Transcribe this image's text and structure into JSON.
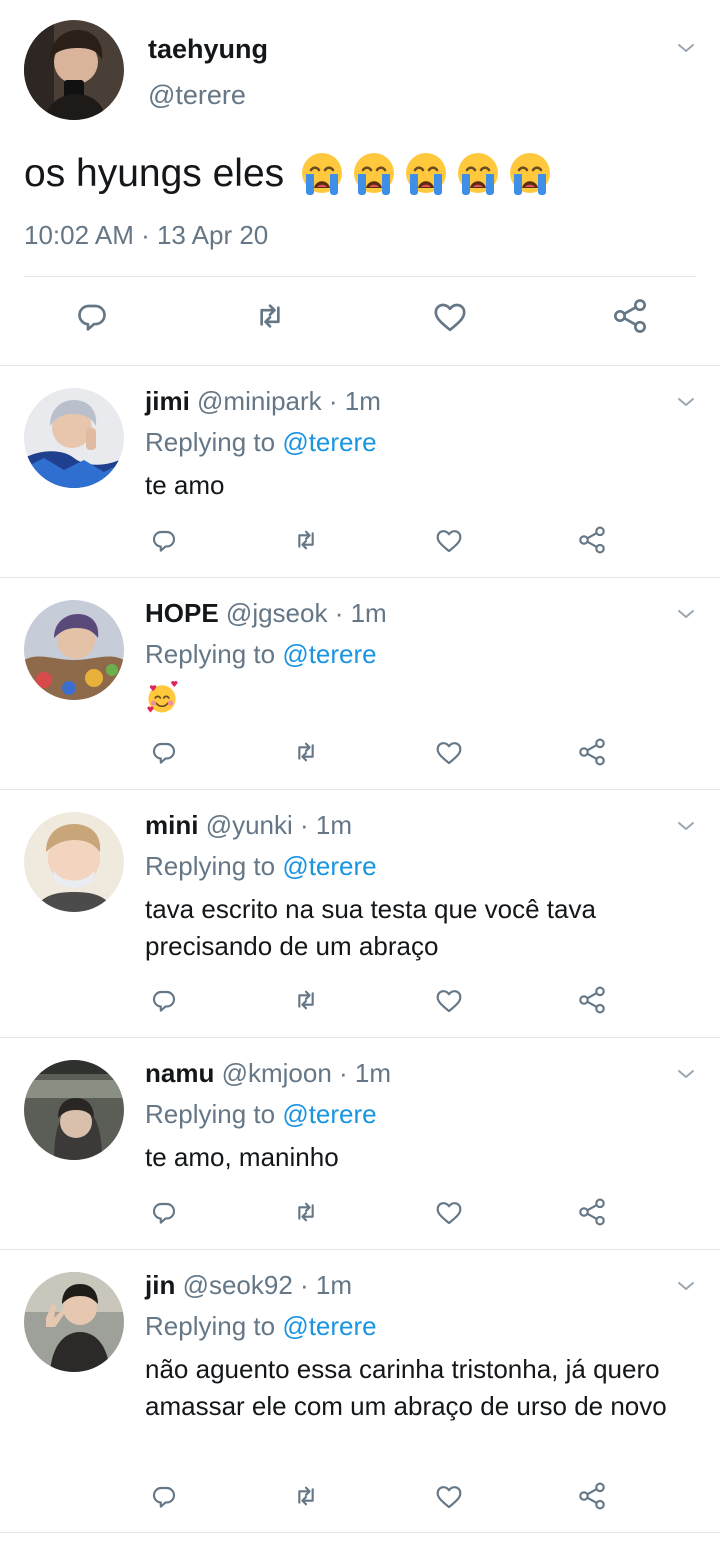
{
  "main_tweet": {
    "name": "taehyung",
    "handle": "@terere",
    "text": "os hyungs eles",
    "emojis": [
      "loudly-crying-face",
      "loudly-crying-face",
      "loudly-crying-face",
      "loudly-crying-face",
      "loudly-crying-face"
    ],
    "timestamp": "10:02 AM · 13 Apr 20"
  },
  "replies": [
    {
      "name": "jimi",
      "handle": "@minipark",
      "time": "· 1m",
      "replying_label": "Replying to",
      "mention": "@terere",
      "text": "te amo"
    },
    {
      "name": "HOPE",
      "handle": "@jgseok",
      "time": "· 1m",
      "replying_label": "Replying to",
      "mention": "@terere",
      "emoji": "smiling-face-with-hearts"
    },
    {
      "name": "mini",
      "handle": "@yunki",
      "time": "· 1m",
      "replying_label": "Replying to",
      "mention": "@terere",
      "text": "tava escrito na sua testa que você tava precisando de um abraço"
    },
    {
      "name": "namu",
      "handle": "@kmjoon",
      "time": "· 1m",
      "replying_label": "Replying to",
      "mention": "@terere",
      "text": "te amo, maninho"
    },
    {
      "name": "jin",
      "handle": "@seok92",
      "time": "· 1m",
      "replying_label": "Replying to",
      "mention": "@terere",
      "text": "não aguento essa carinha tristonha, já quero amassar ele com um abraço de urso de novo"
    }
  ],
  "icons": [
    "reply-icon",
    "retweet-icon",
    "like-icon",
    "share-icon",
    "chevron-down-icon"
  ],
  "colors": {
    "text": "#14171a",
    "secondary": "#657786",
    "link": "#1b95e0",
    "icon": "#657786",
    "divider": "#e1e8ed"
  }
}
